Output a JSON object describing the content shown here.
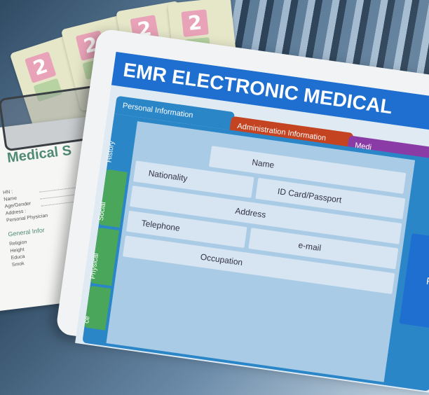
{
  "emr": {
    "title": "EMR ELECTRONIC MEDICAL",
    "tabs": [
      "Personal Information",
      "Administration Information",
      "Medi"
    ],
    "side_tabs": [
      "History",
      "Social",
      "Physical",
      "ce"
    ],
    "fields": {
      "name": "Name",
      "nationality": "Nationality",
      "id_card": "ID Card/Passport",
      "address": "Address",
      "telephone": "Telephone",
      "occupation": "Occupation",
      "email": "e-mail",
      "right_letter": "P"
    }
  },
  "paper": {
    "title": "Medical S",
    "rows": [
      "HN :",
      "Name",
      "Age/Gender",
      "Address :",
      "Personal Physician"
    ],
    "subheading": "General Infor",
    "subrows": [
      "Religion",
      "Height",
      "Educa",
      "Smok"
    ]
  },
  "folders": [
    "2",
    "2",
    "2",
    "2"
  ],
  "colors": {
    "title_bar": "#1f6fd0",
    "personal_tab": "#2b86c8",
    "admin_tab": "#c44422",
    "medical_tab": "#8a3ba6",
    "side_tab": "#4aa65a"
  }
}
